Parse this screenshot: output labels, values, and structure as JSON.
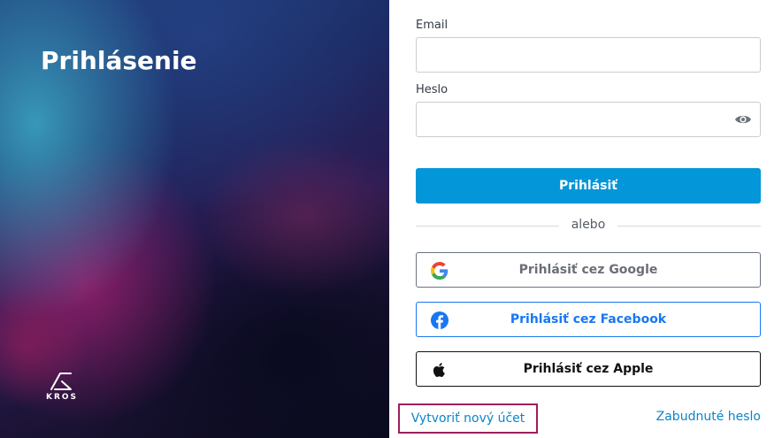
{
  "hero": {
    "title": "Prihlásenie",
    "logo_text": "KROS"
  },
  "form": {
    "email_label": "Email",
    "email_value": "",
    "email_placeholder": "",
    "password_label": "Heslo",
    "password_value": "",
    "password_placeholder": "",
    "show_password_icon": "eye-icon",
    "submit_label": "Prihlásiť",
    "divider_text": "alebo",
    "google_label": "Prihlásiť cez Google",
    "facebook_label": "Prihlásiť cez Facebook",
    "apple_label": "Prihlásiť cez Apple"
  },
  "footer": {
    "create_account": "Vytvoriť nový účet",
    "forgot_password": "Zabudnuté heslo"
  },
  "colors": {
    "primary": "#0396d8",
    "link": "#0a86c9",
    "facebook": "#1877f2",
    "highlight_border": "#9e1e5c"
  }
}
